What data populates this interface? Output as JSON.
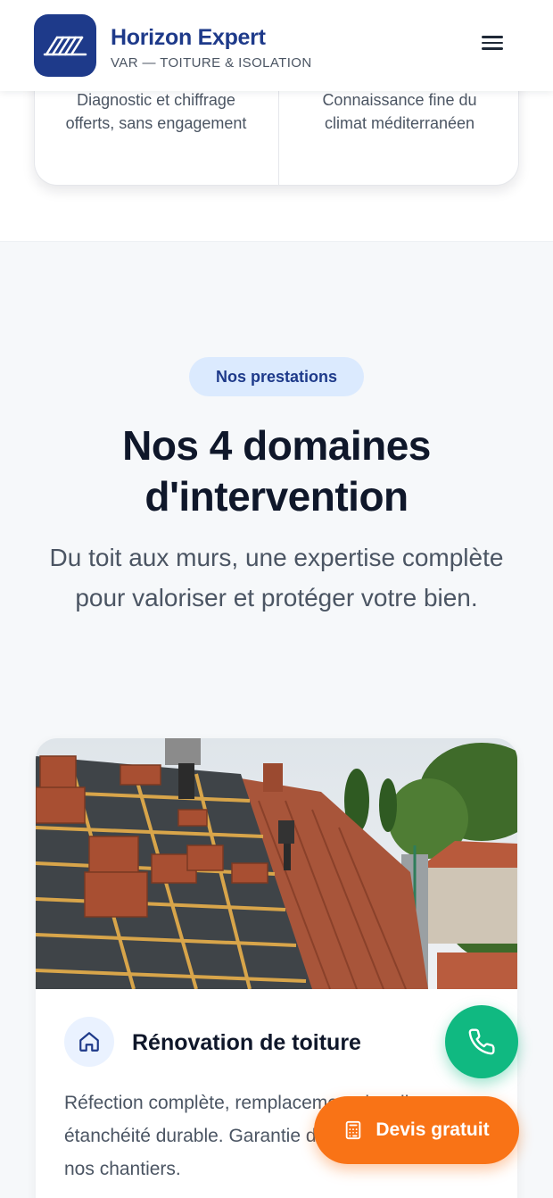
{
  "header": {
    "brand_name": "Horizon Expert",
    "brand_subtitle": "VAR — TOITURE & ISOLATION",
    "menu_icon": "hamburger-menu-icon"
  },
  "features": {
    "left_text": "Diagnostic et chiffrage offerts, sans engagement",
    "right_text": "Connaissance fine du climat méditerranéen"
  },
  "services": {
    "badge": "Nos prestations",
    "title": "Nos 4 domaines d'intervention",
    "description": "Du toit aux murs, une expertise complète pour valoriser et protéger votre bien."
  },
  "card": {
    "image_alt": "Couvreurs posant des tuiles sur une toiture",
    "icon": "home-icon",
    "title": "Rénovation de toiture",
    "description": "Réfection complète, remplacement de tuiles, étanchéité durable. Garantie décennale sur tous nos chantiers."
  },
  "floating": {
    "call_icon": "phone-icon",
    "quote_label": "Devis gratuit",
    "quote_icon": "calculator-icon"
  },
  "colors": {
    "brand_navy": "#1e3a8a",
    "call_green": "#10b981",
    "quote_orange": "#f97316",
    "badge_bg": "#dbeafe"
  }
}
